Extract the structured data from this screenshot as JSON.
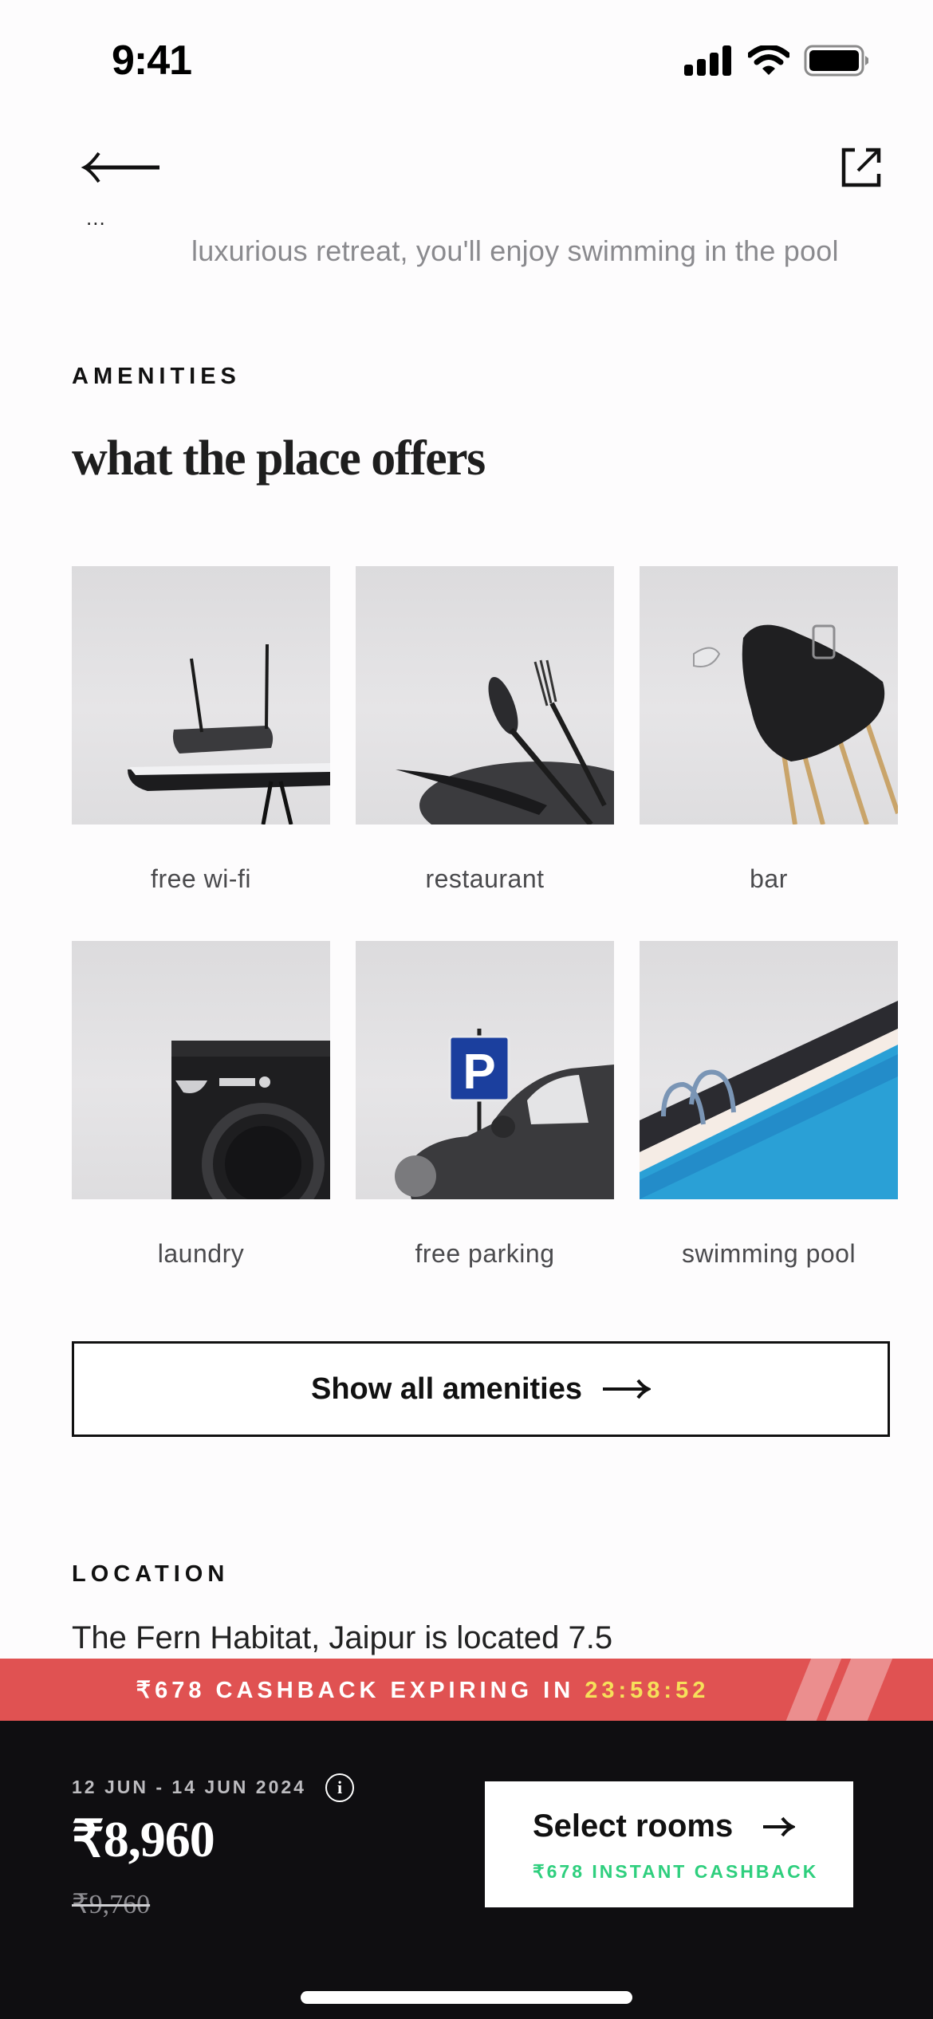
{
  "status_bar": {
    "time": "9:41",
    "icons": [
      "cellular-signal-icon",
      "wifi-icon",
      "battery-icon"
    ]
  },
  "nav": {
    "back_icon": "arrow-left-icon",
    "share_icon": "external-link-icon"
  },
  "description": {
    "partial_top": "...",
    "visible_line": "luxurious retreat, you'll enjoy swimming in the pool"
  },
  "amenities": {
    "eyebrow": "AMENITIES",
    "title": "what the place offers",
    "items": [
      {
        "label": "free wi-fi",
        "image": "router-on-table"
      },
      {
        "label": "restaurant",
        "image": "cutlery-and-plate"
      },
      {
        "label": "bar",
        "image": "bar-stool-with-glasses"
      },
      {
        "label": "laundry",
        "image": "washing-machine"
      },
      {
        "label": "free parking",
        "image": "parking-sign-and-car"
      },
      {
        "label": "swimming pool",
        "image": "pool-ladder"
      }
    ],
    "show_all_label": "Show all amenities"
  },
  "location": {
    "eyebrow": "LOCATION",
    "description": "The Fern Habitat, Jaipur is located 7.5"
  },
  "cashback_banner": {
    "text": "₹678 CASHBACK EXPIRING IN",
    "timer": "23:58:52",
    "colors": {
      "background": "#e05252",
      "timer": "#f6e05a"
    }
  },
  "booking": {
    "dates": "12 JUN - 14 JUN 2024",
    "price": "₹8,960",
    "original_price": "₹9,760",
    "cta_label": "Select rooms",
    "cta_sub": "₹678 INSTANT CASHBACK",
    "cta_sub_color": "#2fcf7e"
  }
}
